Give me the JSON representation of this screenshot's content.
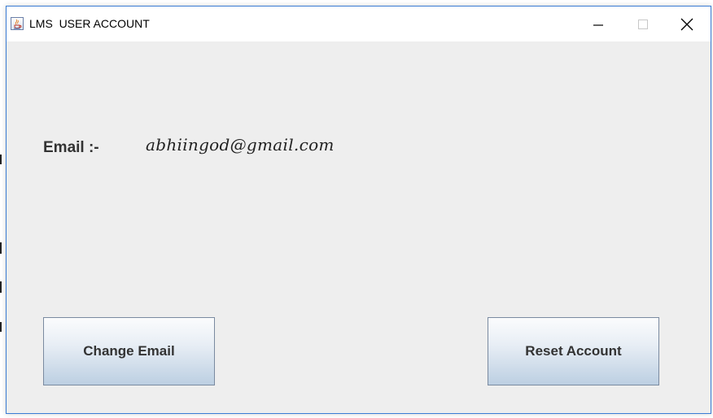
{
  "window": {
    "title": "LMS  USER ACCOUNT",
    "app_icon": "java-cup-icon",
    "controls": {
      "minimize_icon": "minimize-icon",
      "maximize_icon": "maximize-icon",
      "close_icon": "close-icon"
    }
  },
  "account": {
    "email_label": "Email :-",
    "email_value": "abhiingod@gmail.com"
  },
  "actions": {
    "change_email_label": "Change Email",
    "reset_account_label": "Reset Account"
  },
  "colors": {
    "window_border": "#3a7cd4",
    "content_background": "#eeeeee",
    "button_gradient_top": "#fbfcfd",
    "button_gradient_bottom": "#bccfe2"
  }
}
